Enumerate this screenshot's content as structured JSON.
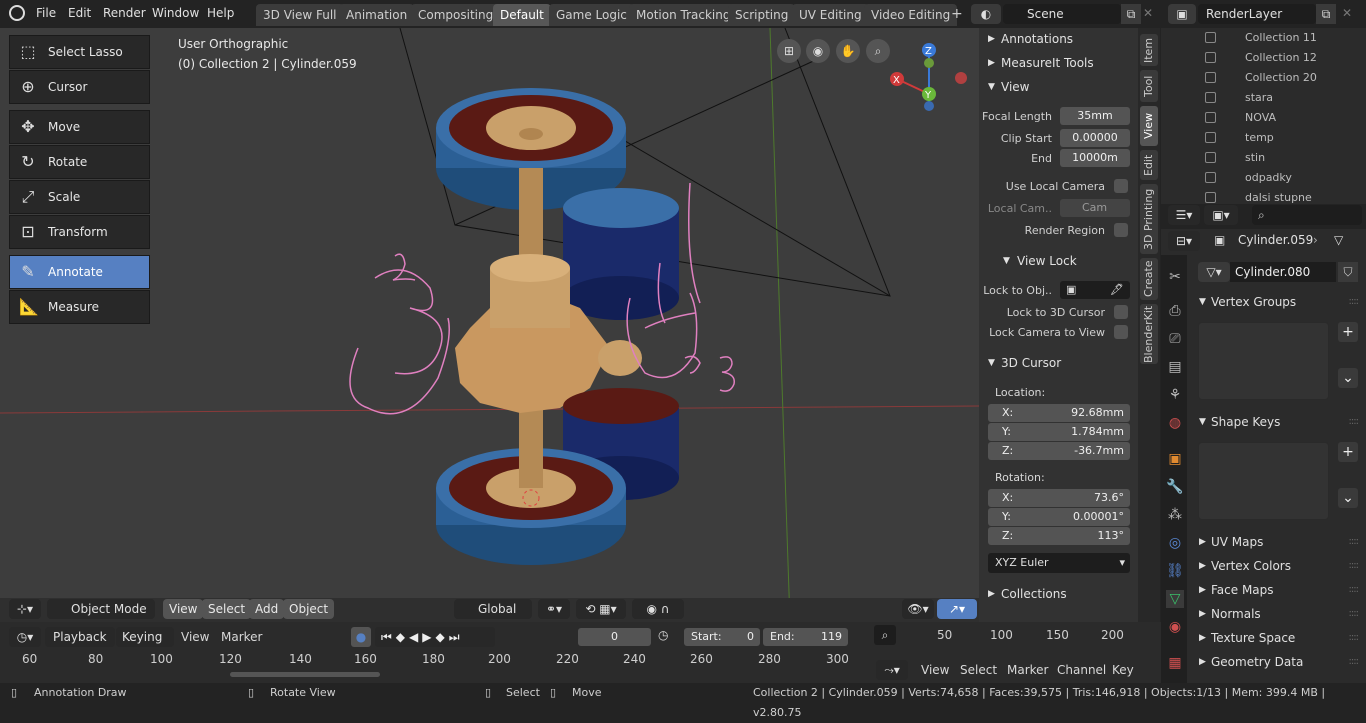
{
  "menu": [
    "File",
    "Edit",
    "Render",
    "Window",
    "Help"
  ],
  "workspace_tabs": [
    "3D View Full",
    "Animation",
    "Compositing",
    "Default",
    "Game Logic",
    "Motion Tracking",
    "Scripting",
    "UV Editing",
    "Video Editing"
  ],
  "active_tab": "Default",
  "scene": "Scene",
  "render_layer": "RenderLayer",
  "viewport": {
    "view_name": "User Orthographic",
    "collection": "(0) Collection 2 | Cylinder.059"
  },
  "tools": [
    "Select Lasso",
    "Cursor",
    "Move",
    "Rotate",
    "Scale",
    "Transform",
    "Annotate",
    "Measure"
  ],
  "active_tool": "Annotate",
  "header3d": {
    "mode": "Object Mode",
    "view": "View",
    "select": "Select",
    "add": "Add",
    "object": "Object",
    "transform": "Global"
  },
  "npanel": {
    "annotations": "Annotations",
    "measureit": "MeasureIt Tools",
    "view": "View",
    "focal_label": "Focal Length",
    "focal": "35mm",
    "clip_start_label": "Clip Start",
    "clip_start": "0.00000",
    "end_label": "End",
    "end": "10000m",
    "use_local_camera": "Use Local Camera",
    "local_cam_label": "Local Cam..",
    "local_cam": "Cam",
    "render_region": "Render Region",
    "view_lock": "View Lock",
    "lock_obj": "Lock to Obj..",
    "lock_cursor": "Lock to 3D Cursor",
    "lock_camera": "Lock Camera to View",
    "cursor": "3D Cursor",
    "location": "Location:",
    "loc": [
      {
        "axis": "X:",
        "value": "92.68mm"
      },
      {
        "axis": "Y:",
        "value": "1.784mm"
      },
      {
        "axis": "Z:",
        "value": "-36.7mm"
      }
    ],
    "rotation": "Rotation:",
    "rot": [
      {
        "axis": "X:",
        "value": "73.6°"
      },
      {
        "axis": "Y:",
        "value": "0.00001°"
      },
      {
        "axis": "Z:",
        "value": "113°"
      }
    ],
    "rot_mode": "XYZ Euler",
    "collections": "Collections"
  },
  "side_tabs": [
    "Item",
    "Tool",
    "View",
    "Edit",
    "3D Printing",
    "Create",
    "BlenderKit"
  ],
  "outliner": [
    "Collection 11",
    "Collection 12",
    "Collection 20",
    "stara",
    "NOVA",
    "temp",
    "stin",
    "odpadky",
    "dalsi stupne"
  ],
  "props": {
    "object": "Cylinder.059",
    "mesh": "Cylinder.080",
    "vertex_groups": "Vertex Groups",
    "shape_keys": "Shape Keys",
    "sections": [
      "UV Maps",
      "Vertex Colors",
      "Face Maps",
      "Normals",
      "Texture Space",
      "Geometry Data"
    ]
  },
  "timeline": {
    "playback": "Playback",
    "keying": "Keying",
    "view": "View",
    "marker": "Marker",
    "frame": "0",
    "start_label": "Start:",
    "start": "0",
    "end_label": "End:",
    "end": "119",
    "ruler": [
      "60",
      "80",
      "100",
      "120",
      "140",
      "160",
      "180",
      "200",
      "220",
      "240",
      "260",
      "280",
      "300"
    ]
  },
  "graph": {
    "ruler": [
      "50",
      "100",
      "150",
      "200"
    ],
    "menu": [
      "View",
      "Select",
      "Marker",
      "Channel",
      "Key"
    ]
  },
  "status": {
    "left": "Annotation Draw",
    "mid1": "Rotate View",
    "mid2": "Select",
    "mid3": "Move",
    "right": "Collection 2 | Cylinder.059 | Verts:74,658 | Faces:39,575 | Tris:146,918 | Objects:1/13 | Mem: 399.4 MB | v2.80.75"
  },
  "annotation_text": [
    "2",
    "3"
  ]
}
